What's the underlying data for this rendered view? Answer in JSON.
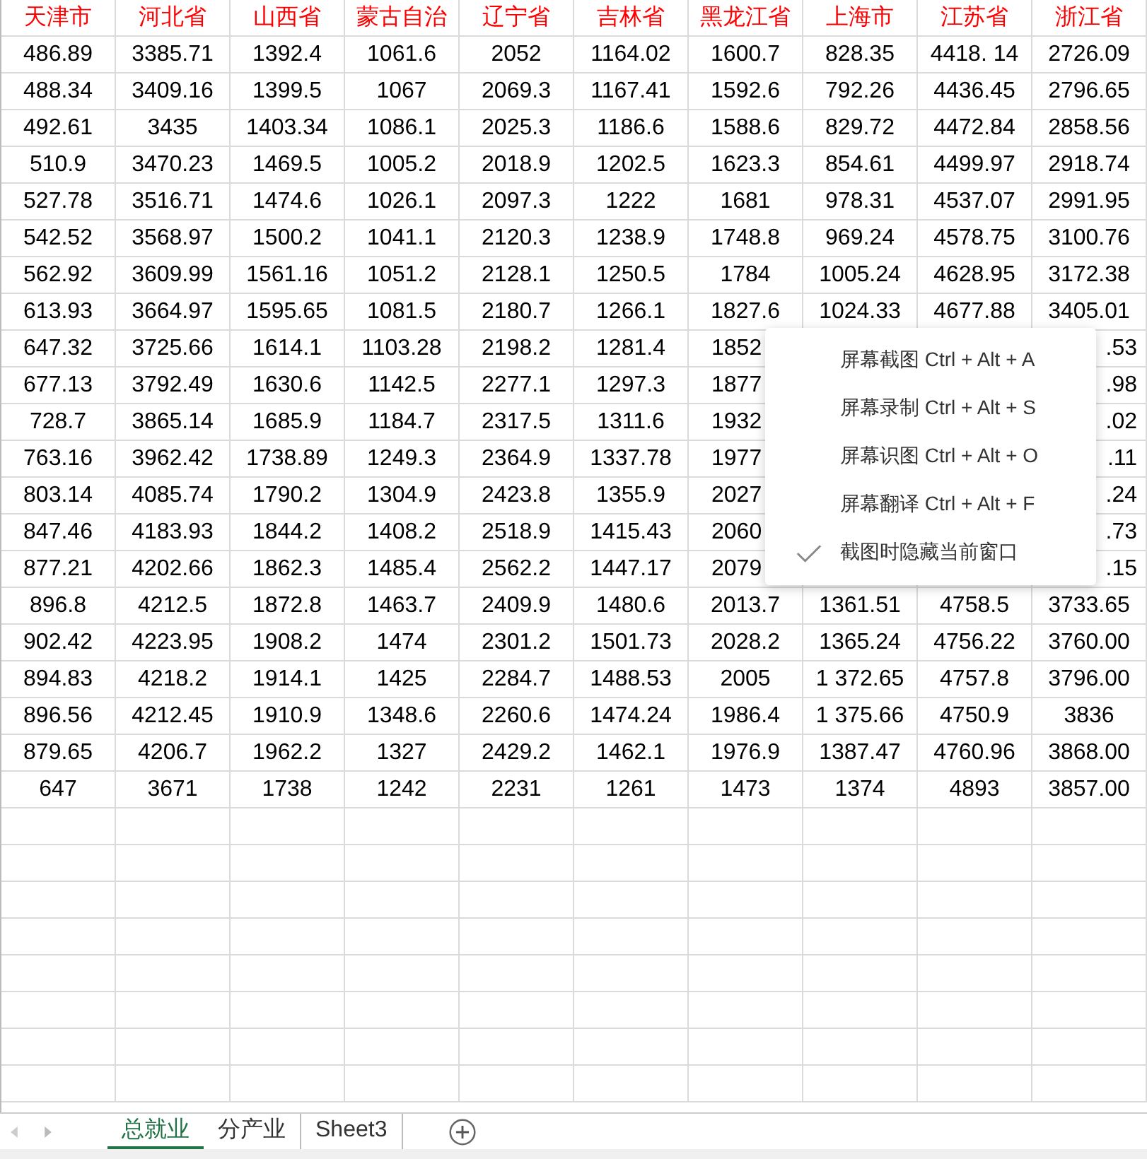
{
  "columns": [
    "天津市",
    "河北省",
    "山西省",
    "蒙古自治",
    "辽宁省",
    "吉林省",
    "黑龙江省",
    "上海市",
    "江苏省",
    "浙江省"
  ],
  "rows": [
    {
      "cells": [
        "486.89",
        "3385.71",
        "1392.4",
        "1061.6",
        "2052",
        "1164.02",
        "1600.7",
        "828.35",
        "4418. 14",
        "2726.09"
      ]
    },
    {
      "cells": [
        "488.34",
        "3409.16",
        "1399.5",
        "1067",
        "2069.3",
        "1167.41",
        "1592.6",
        "792.26",
        "4436.45",
        "2796.65"
      ]
    },
    {
      "cells": [
        "492.61",
        "3435",
        "1403.34",
        "1086.1",
        "2025.3",
        "1186.6",
        "1588.6",
        "829.72",
        "4472.84",
        "2858.56"
      ]
    },
    {
      "cells": [
        "510.9",
        "3470.23",
        "1469.5",
        "1005.2",
        "2018.9",
        "1202.5",
        "1623.3",
        "854.61",
        "4499.97",
        "2918.74"
      ]
    },
    {
      "cells": [
        "527.78",
        "3516.71",
        "1474.6",
        "1026.1",
        "2097.3",
        "1222",
        "1681",
        "978.31",
        "4537.07",
        "2991.95"
      ]
    },
    {
      "cells": [
        "542.52",
        "3568.97",
        "1500.2",
        "1041.1",
        "2120.3",
        "1238.9",
        "1748.8",
        "969.24",
        "4578.75",
        "3100.76"
      ]
    },
    {
      "cells": [
        "562.92",
        "3609.99",
        "1561.16",
        "1051.2",
        "2128.1",
        "1250.5",
        "1784",
        "1005.24",
        "4628.95",
        "3172.38"
      ]
    },
    {
      "cells": [
        "613.93",
        "3664.97",
        "1595.65",
        "1081.5",
        "2180.7",
        "1266.1",
        "1827.6",
        "1024.33",
        "4677.88",
        "3405.01"
      ]
    },
    {
      "cells": [
        "647.32",
        "3725.66",
        "1614.1",
        "1103.28",
        "2198.2",
        "1281.4",
        "1852"
      ],
      "tail": ".53"
    },
    {
      "cells": [
        "677.13",
        "3792.49",
        "1630.6",
        "1142.5",
        "2277.1",
        "1297.3",
        "1877"
      ],
      "tail": ".98"
    },
    {
      "cells": [
        "728.7",
        "3865.14",
        "1685.9",
        "1184.7",
        "2317.5",
        "1311.6",
        "1932"
      ],
      "tail": ".02"
    },
    {
      "cells": [
        "763.16",
        "3962.42",
        "1738.89",
        "1249.3",
        "2364.9",
        "1337.78",
        "1977"
      ],
      "tail": ".11"
    },
    {
      "cells": [
        "803.14",
        "4085.74",
        "1790.2",
        "1304.9",
        "2423.8",
        "1355.9",
        "2027"
      ],
      "tail": ".24"
    },
    {
      "cells": [
        "847.46",
        "4183.93",
        "1844.2",
        "1408.2",
        "2518.9",
        "1415.43",
        "2060"
      ],
      "tail": ".73"
    },
    {
      "cells": [
        "877.21",
        "4202.66",
        "1862.3",
        "1485.4",
        "2562.2",
        "1447.17",
        "2079"
      ],
      "tail": ".15"
    },
    {
      "cells": [
        "896.8",
        "4212.5",
        "1872.8",
        "1463.7",
        "2409.9",
        "1480.6",
        "2013.7",
        "1361.51",
        "4758.5",
        "3733.65"
      ]
    },
    {
      "cells": [
        "902.42",
        "4223.95",
        "1908.2",
        "1474",
        "2301.2",
        "1501.73",
        "2028.2",
        "1365.24",
        "4756.22",
        "3760.00"
      ]
    },
    {
      "cells": [
        "894.83",
        "4218.2",
        "1914.1",
        "1425",
        "2284.7",
        "1488.53",
        "2005",
        "1 372.65",
        "4757.8",
        "3796.00"
      ]
    },
    {
      "cells": [
        "896.56",
        "4212.45",
        "1910.9",
        "1348.6",
        "2260.6",
        "1474.24",
        "1986.4",
        "1 375.66",
        "4750.9",
        "3836"
      ]
    },
    {
      "cells": [
        "879.65",
        "4206.7",
        "1962.2",
        "1327",
        "2429.2",
        "1462.1",
        "1976.9",
        "1387.47",
        "4760.96",
        "3868.00"
      ]
    },
    {
      "cells": [
        "647",
        "3671",
        "1738",
        "1242",
        "2231",
        "1261",
        "1473",
        "1374",
        "4893",
        "3857.00"
      ]
    }
  ],
  "context_menu": [
    {
      "label": "屏幕截图 Ctrl + Alt + A",
      "checked": false
    },
    {
      "label": "屏幕录制 Ctrl + Alt + S",
      "checked": false
    },
    {
      "label": "屏幕识图 Ctrl + Alt + O",
      "checked": false
    },
    {
      "label": "屏幕翻译 Ctrl + Alt + F",
      "checked": false
    },
    {
      "label": "截图时隐藏当前窗口",
      "checked": true
    }
  ],
  "sheet_tabs": [
    {
      "label": "总就业",
      "selected": true
    },
    {
      "label": "分产业",
      "selected": false
    },
    {
      "label": "Sheet3",
      "selected": false
    }
  ]
}
